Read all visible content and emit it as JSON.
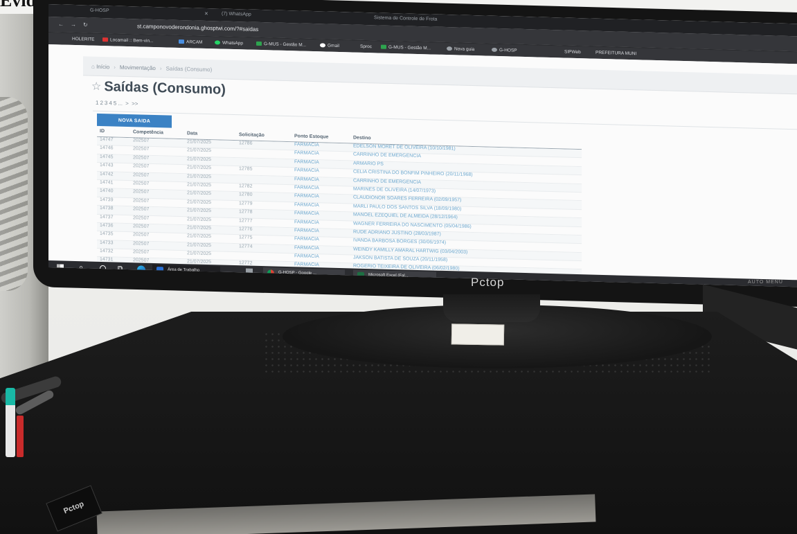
{
  "caption": "Evidências:",
  "browser": {
    "tabs": [
      "G-HOSP",
      "(7) WhatsApp",
      "Sistema de Controle de Frota"
    ],
    "url": "st.camponovoderondonia.ghosptwi.com/?#saidas",
    "bookmarks": [
      "HOLERITE",
      "Locamail :: Bem-vin...",
      "ARCAM",
      "WhatsApp",
      "G-MUS - Gestão M...",
      "Gmail",
      "Sproc",
      "G-MUS - Gestão M...",
      "Nova guia",
      "G-HOSP",
      "SIPWeb",
      "PREFEITURA MUNI"
    ]
  },
  "breadcrumb": [
    "Início",
    "Movimentação",
    "Saídas (Consumo)"
  ],
  "page_title": "Saídas (Consumo)",
  "pager": [
    "1",
    "2",
    "3",
    "4",
    "5",
    "...",
    ">",
    ">>"
  ],
  "new_button": "NOVA SAIDA",
  "table": {
    "headers": [
      "ID",
      "Competência",
      "Data",
      "Solicitação",
      "Ponto Estoque",
      "Destino"
    ],
    "rows": [
      [
        "14747",
        "202507",
        "21/07/2025",
        "12786",
        "FARMACIA",
        "EDELSON MORET DE OLIVEIRA (10/10/1981)"
      ],
      [
        "14746",
        "202507",
        "21/07/2025",
        "",
        "FARMACIA",
        "CARRINHO DE EMERGENCIA"
      ],
      [
        "14745",
        "202507",
        "21/07/2025",
        "",
        "FARMACIA",
        "ARMARIO PS"
      ],
      [
        "14743",
        "202507",
        "21/07/2025",
        "12785",
        "FARMACIA",
        "CELIA CRISTINA DO BONFIM PINHEIRO (20/11/1968)"
      ],
      [
        "14742",
        "202507",
        "21/07/2025",
        "",
        "FARMACIA",
        "CARRINHO DE EMERGENCIA"
      ],
      [
        "14741",
        "202507",
        "21/07/2025",
        "12782",
        "FARMACIA",
        "MARINES DE OLIVEIRA (14/07/1973)"
      ],
      [
        "14740",
        "202507",
        "21/07/2025",
        "12780",
        "FARMACIA",
        "CLAUDIONOR SOARES FERREIRA (02/09/1957)"
      ],
      [
        "14739",
        "202507",
        "21/07/2025",
        "12779",
        "FARMACIA",
        "MARLI PAULO DOS SANTOS SILVA (18/09/1980)"
      ],
      [
        "14738",
        "202507",
        "21/07/2025",
        "12778",
        "FARMACIA",
        "MANOEL EZEQUIEL DE ALMEIDA (28/12/1964)"
      ],
      [
        "14737",
        "202507",
        "21/07/2025",
        "12777",
        "FARMACIA",
        "WAGNER FERREIRA DO NASCIMENTO (05/04/1986)"
      ],
      [
        "14736",
        "202507",
        "21/07/2025",
        "12776",
        "FARMACIA",
        "RUDE ADRIANO JUSTINO (28/03/1987)"
      ],
      [
        "14735",
        "202507",
        "21/07/2025",
        "12775",
        "FARMACIA",
        "IVANDA BARBOSA BORGES (30/06/1974)"
      ],
      [
        "14733",
        "202507",
        "21/07/2025",
        "12774",
        "FARMACIA",
        "WEINDY KAMILLY AMARAL HARTWIG (03/04/2003)"
      ],
      [
        "14732",
        "202507",
        "21/07/2025",
        "",
        "FARMACIA",
        "JAKSON BATISTA DE SOUZA (20/11/1958)"
      ],
      [
        "14731",
        "202507",
        "21/07/2025",
        "12772",
        "FARMACIA",
        "ROGERIO TEIXEIRA DE OLIVEIRA (06/02/1980)"
      ]
    ]
  },
  "taskbar": {
    "desktop_label": "Área de Trabalho",
    "chrome_label": "G-HOSP - Google ...",
    "excel_label": "Microsoft Excel (Fal..."
  },
  "monitor_brand": "Pctop",
  "monitor_osd": "AUTO  MENU",
  "case_label": "Pctop"
}
